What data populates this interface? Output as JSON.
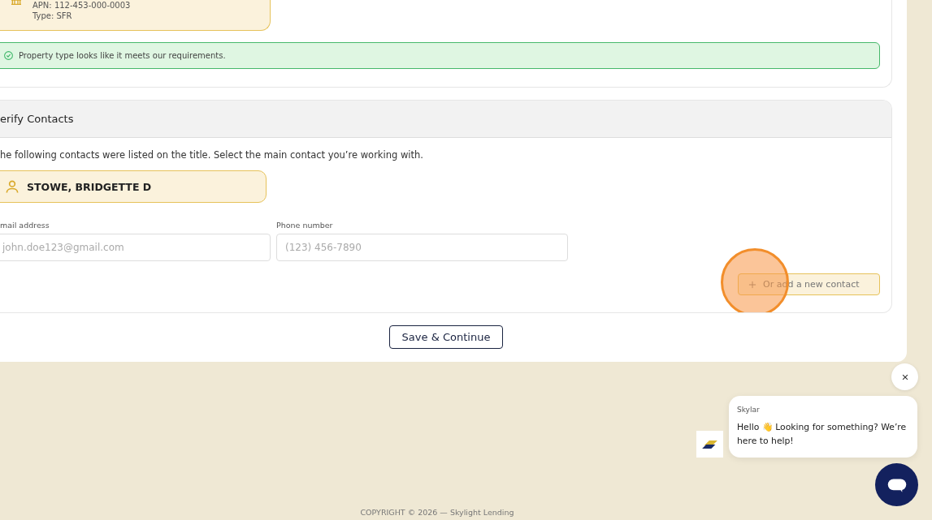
{
  "property_section": {
    "property_card": {
      "apn": "APN: 112-453-000-0003",
      "type": "Type: SFR"
    },
    "alert": {
      "kind": "success",
      "text": "Property type looks like it meets our requirements."
    }
  },
  "contacts_section": {
    "title": "erify Contacts",
    "intro": "he following contacts were listed on the title. Select the main contact you’re working with.",
    "contacts": [
      {
        "name": "STOWE, BRIDGETTE D",
        "selected": true
      }
    ],
    "fields": [
      {
        "label": "mail address",
        "placeholder": "john.doe123@gmail.com"
      },
      {
        "label": "Phone number",
        "placeholder": "(123) 456-7890"
      }
    ],
    "add_button": "Or add a new contact",
    "click_highlight": true
  },
  "save_button": "Save & Continue",
  "chat": {
    "sender": "Skylar",
    "message": "Hello 👋 Looking for something? We’re here to help!"
  },
  "footer": "COPYRIGHT © 2026 — Skylight Lending"
}
